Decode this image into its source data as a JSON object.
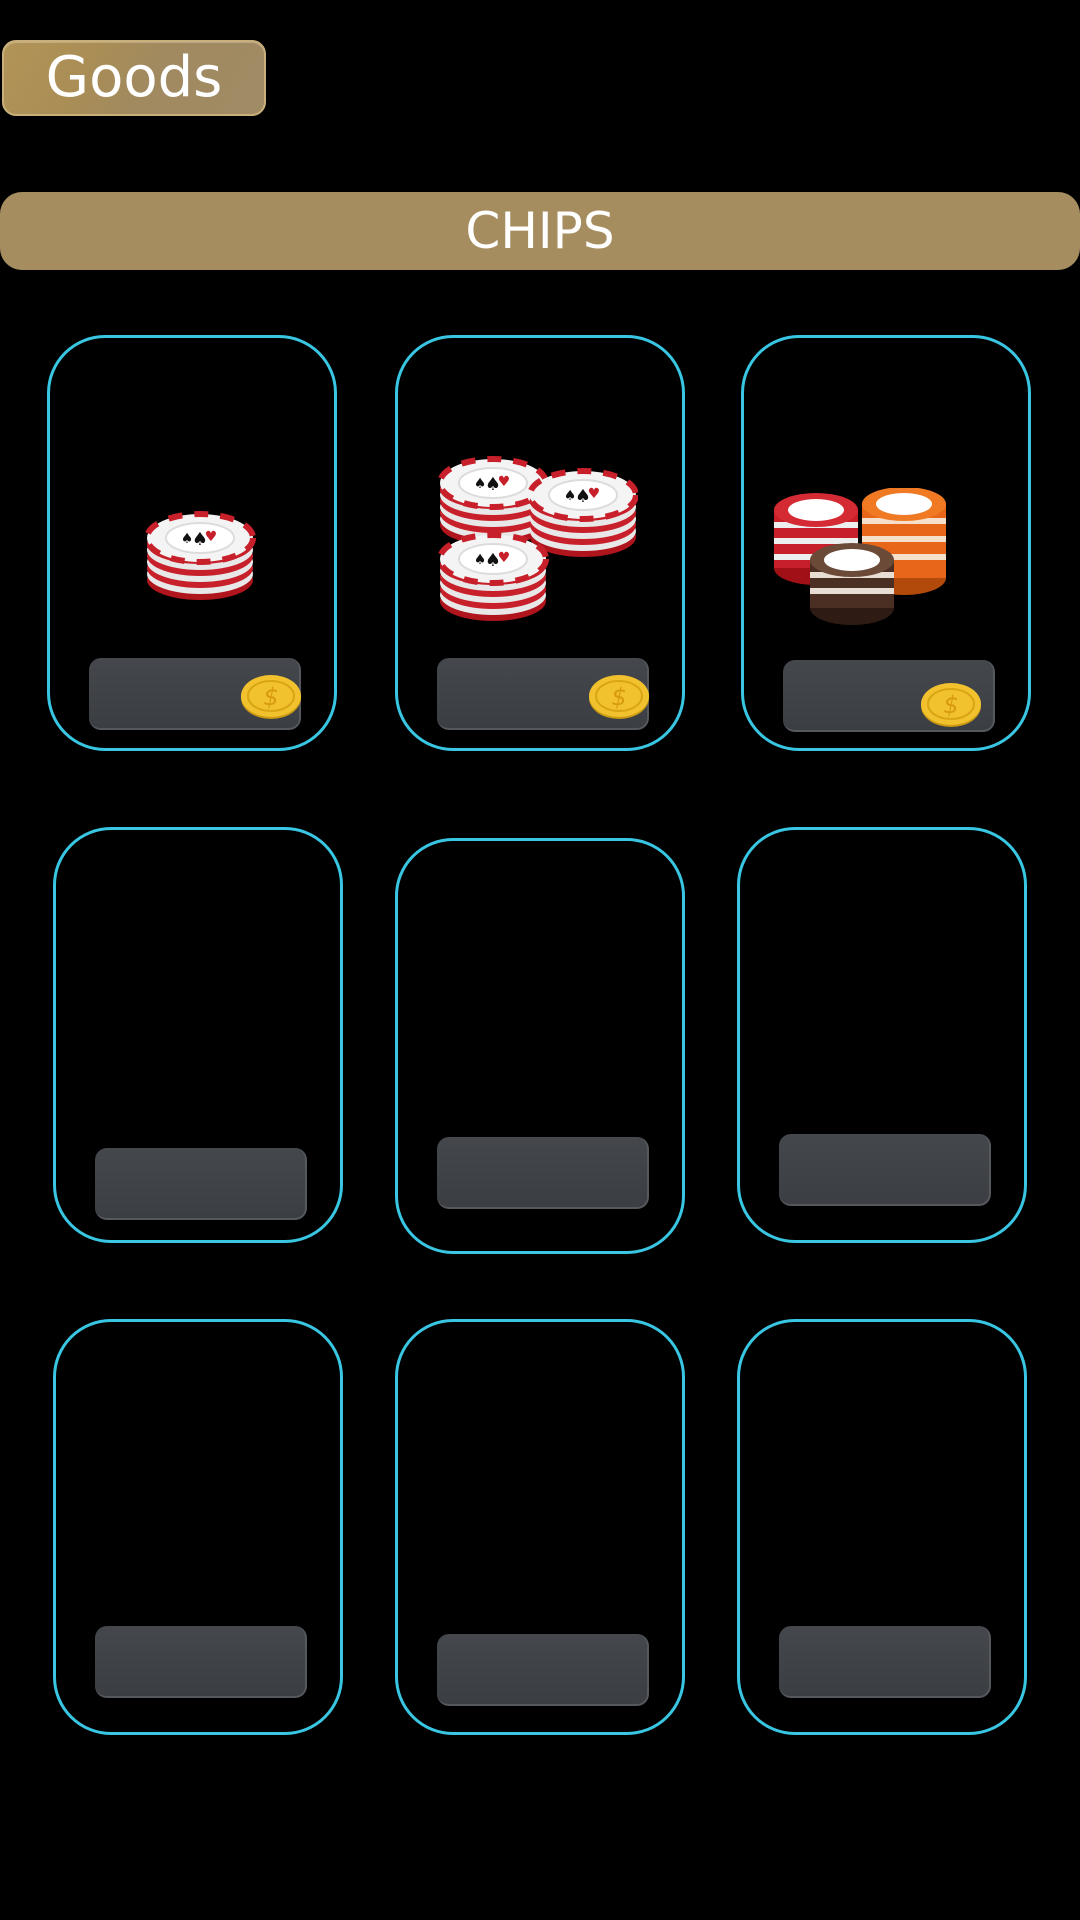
{
  "header": {
    "goods_label": "Goods"
  },
  "section": {
    "title": "CHIPS"
  },
  "colors": {
    "accent_gold": "#a68d5f",
    "card_border": "#38c6e2",
    "price_bg": "#3f4247",
    "coin": "#f2c12e",
    "chip_red": "#c8202a"
  },
  "items": [
    {
      "icon": "chip-stack-small-icon",
      "price_icon": "coin-icon"
    },
    {
      "icon": "chip-stack-medium-icon",
      "price_icon": "coin-icon"
    },
    {
      "icon": "chip-stack-large-icon",
      "price_icon": "coin-icon"
    },
    {
      "icon": ""
    },
    {
      "icon": ""
    },
    {
      "icon": ""
    },
    {
      "icon": ""
    },
    {
      "icon": ""
    },
    {
      "icon": ""
    }
  ]
}
